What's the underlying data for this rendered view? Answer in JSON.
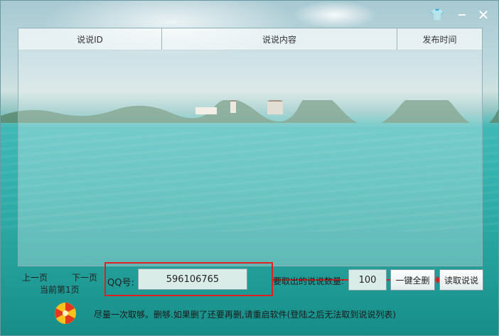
{
  "window": {
    "controls": {
      "skin": "👕",
      "minimize": "−",
      "close": "✕"
    }
  },
  "table": {
    "columns": [
      "说说ID",
      "说说内容",
      "发布时间"
    ],
    "rows": []
  },
  "pagination": {
    "prev_label": "上一页",
    "next_label": "下一页",
    "current_label": "当前第1页"
  },
  "form": {
    "qq_label": "QQ号:",
    "qq_value": "596106765",
    "count_label": "要取出的说说数量:",
    "count_value": "100"
  },
  "buttons": {
    "delete_all": "一键全删",
    "read": "读取说说"
  },
  "footer": {
    "notice": "尽量一次取够。删够.如果删了还要再删,请重启软件(登陆之后无法取到说说列表)"
  },
  "colors": {
    "highlight": "#e02020"
  }
}
